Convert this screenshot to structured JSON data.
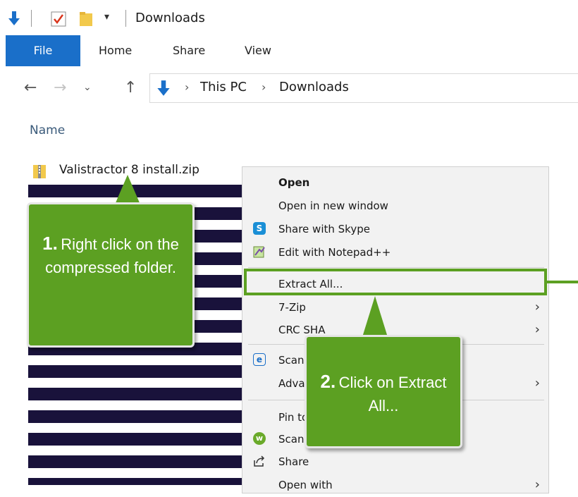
{
  "window": {
    "title": "Downloads"
  },
  "ribbon": {
    "tabs": [
      "File",
      "Home",
      "Share",
      "View"
    ]
  },
  "address": {
    "crumbs": [
      "This PC",
      "Downloads"
    ]
  },
  "list": {
    "column_header": "Name",
    "file_name": "Valistractor 8 install.zip"
  },
  "context_menu": {
    "items": [
      {
        "label": "Open",
        "bold": true,
        "icon": ""
      },
      {
        "label": "Open in new window",
        "icon": ""
      },
      {
        "label": "Share with Skype",
        "icon": "skype-icon"
      },
      {
        "label": "Edit with Notepad++",
        "icon": "notepadpp-icon"
      },
      {
        "label": "Extract All...",
        "icon": "",
        "highlighted": true
      },
      {
        "label": "7-Zip",
        "icon": "",
        "submenu": true
      },
      {
        "label": "CRC SHA",
        "icon": "",
        "submenu": true
      },
      {
        "label": "Scan",
        "icon": "eset-icon"
      },
      {
        "label": "Adva",
        "icon": "",
        "submenu": true
      },
      {
        "label": "Pin to",
        "icon": ""
      },
      {
        "label": "Scan",
        "icon": "webroot-icon"
      },
      {
        "label": "Share",
        "icon": "share-icon"
      },
      {
        "label": "Open with",
        "icon": "",
        "submenu": true
      }
    ]
  },
  "callouts": {
    "step1": {
      "number": "1.",
      "text": "Right click on the compressed folder."
    },
    "step2": {
      "number": "2.",
      "text": "Click on Extract All..."
    }
  },
  "colors": {
    "accent": "#5ca022",
    "file_tab": "#1a6fc9",
    "stripe": "#19123b"
  }
}
